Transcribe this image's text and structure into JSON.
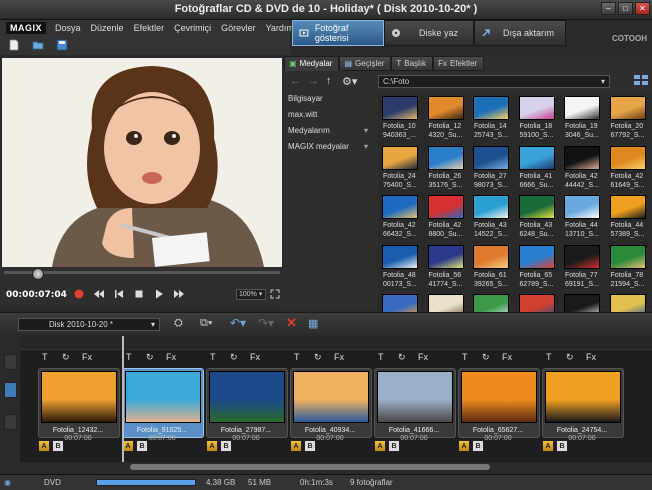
{
  "window": {
    "title": "Fotoğraflar CD & DVD de 10 - Holiday* ( Disk 2010-10-20* )",
    "controls": [
      "minimize",
      "maximize",
      "close"
    ]
  },
  "menu": {
    "logo": "MAGIX",
    "items": [
      "Dosya",
      "Düzenle",
      "Efektler",
      "Çevrimiçi",
      "Görevler",
      "Yardım"
    ]
  },
  "quickbar": {
    "icons": [
      "new-document-icon",
      "open-folder-icon",
      "save-icon"
    ]
  },
  "mode_tabs": [
    {
      "label": "Fotoğraf gösterisi",
      "active": true
    },
    {
      "label": "Diske yaz",
      "active": false
    },
    {
      "label": "Dışa aktarım",
      "active": false
    }
  ],
  "brand": "COTOOH",
  "player": {
    "timecode": "00:00:07:04",
    "zoom": "100%"
  },
  "media_pool": {
    "tabs": [
      {
        "label": "Medyalar",
        "active": true
      },
      {
        "label": "Geçişler",
        "active": false
      },
      {
        "label": "Başlık",
        "active": false
      },
      {
        "label": "Efektler",
        "active": false
      }
    ],
    "path": "C:\\Foto",
    "tree": [
      {
        "label": "Bilgisayar",
        "dropdown": false
      },
      {
        "label": "max.witt",
        "dropdown": false
      },
      {
        "label": "Medyalarım",
        "dropdown": true
      },
      {
        "label": "MAGIX medyalar",
        "dropdown": true
      }
    ],
    "files": [
      [
        "Fotolia_10",
        "940363_..."
      ],
      [
        "Fotolia_12",
        "4320_Su..."
      ],
      [
        "Fotolia_14",
        "25743_S..."
      ],
      [
        "Fotolia_18",
        "59100_S..."
      ],
      [
        "Fotolia_19",
        "3046_Su..."
      ],
      [
        "Fotolia_20",
        "67792_S..."
      ],
      [
        "Fotolia_24",
        "75400_S..."
      ],
      [
        "Fotolia_26",
        "35176_S..."
      ],
      [
        "Fotolia_27",
        "98073_S..."
      ],
      [
        "Fotolia_41",
        "6666_Su..."
      ],
      [
        "Fotolia_42",
        "44442_S..."
      ],
      [
        "Fotolia_42",
        "61649_S..."
      ],
      [
        "Fotolia_42",
        "66432_S..."
      ],
      [
        "Fotolia_42",
        "8800_Su..."
      ],
      [
        "Fotolia_43",
        "14522_S..."
      ],
      [
        "Fotolia_43",
        "6248_Su..."
      ],
      [
        "Fotolia_44",
        "13710_S..."
      ],
      [
        "Fotolia_44",
        "57389_S..."
      ],
      [
        "Fotolia_48",
        "00173_S..."
      ],
      [
        "Fotolia_56",
        "41774_S..."
      ],
      [
        "Fotolia_61",
        "39265_S..."
      ],
      [
        "Fotolia_65",
        "62789_S..."
      ],
      [
        "Fotolia_77",
        "69191_S..."
      ],
      [
        "Fotolia_78",
        "21594_S..."
      ],
      [
        "",
        ""
      ],
      [
        "",
        ""
      ],
      [
        "",
        ""
      ],
      [
        "",
        ""
      ],
      [
        "",
        ""
      ],
      [
        "",
        ""
      ]
    ]
  },
  "timeline": {
    "disk": "Disk 2010-10-20 *",
    "clips": [
      {
        "name": "Fotolia_12432...",
        "duration": "00:07:00",
        "selected": false
      },
      {
        "name": "Fotolia_91025...",
        "duration": "00:07:00",
        "selected": true
      },
      {
        "name": "Fotolia_27987...",
        "duration": "00:07:00",
        "selected": false
      },
      {
        "name": "Fotolia_40934...",
        "duration": "00:07:00",
        "selected": false
      },
      {
        "name": "Fotolia_41666...",
        "duration": "00:07:00",
        "selected": false
      },
      {
        "name": "Fotolia_65627...",
        "duration": "00:07:00",
        "selected": false
      },
      {
        "name": "Fotolia_24754...",
        "duration": "00:07:00",
        "selected": false
      }
    ],
    "clip_tools": [
      "T",
      "↻",
      "Fx"
    ],
    "ab_labels": [
      "A",
      "B"
    ]
  },
  "status": {
    "format": "DVD",
    "capacity": "4.38 GB",
    "used": "51 MB",
    "duration": "0h:1m:3s",
    "count": "9 fotoğraflar"
  }
}
